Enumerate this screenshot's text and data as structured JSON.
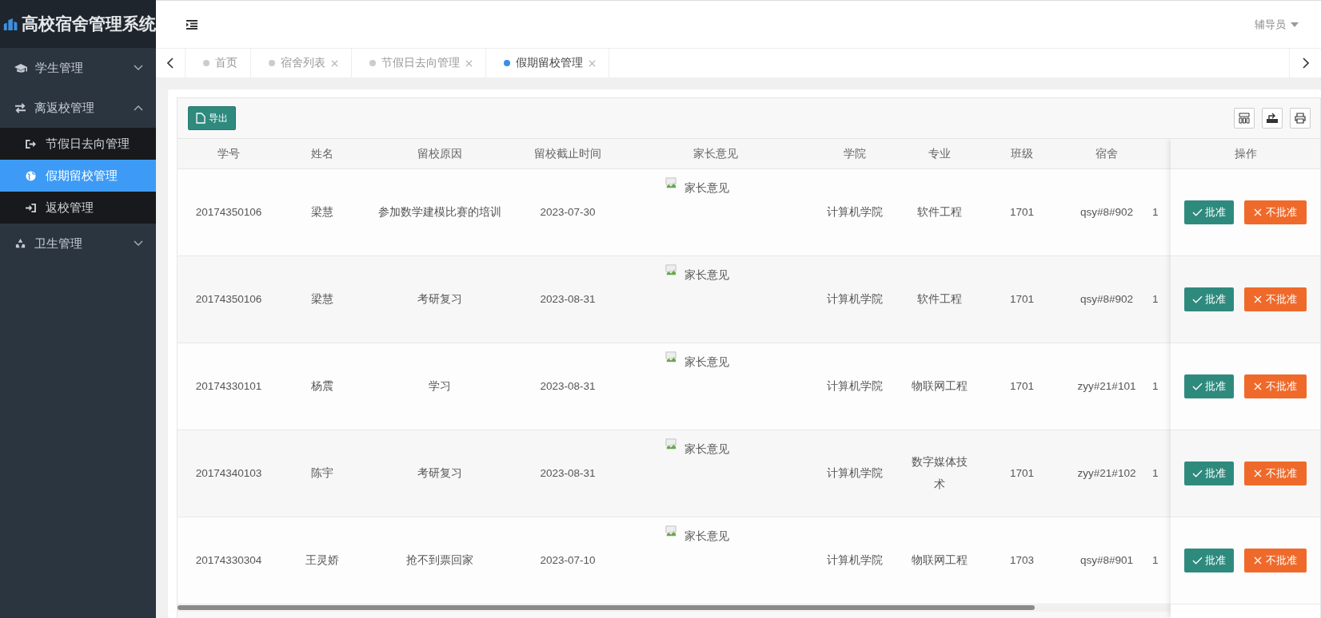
{
  "sidebar": {
    "logo": "高校宿舍管理系统",
    "items": [
      {
        "label": "学生管理",
        "expanded": false
      },
      {
        "label": "离返校管理",
        "expanded": true,
        "children": [
          {
            "label": "节假日去向管理",
            "selected": false
          },
          {
            "label": "假期留校管理",
            "selected": true
          },
          {
            "label": "返校管理",
            "selected": false
          }
        ]
      },
      {
        "label": "卫生管理",
        "expanded": false
      }
    ]
  },
  "header": {
    "user": "辅导员"
  },
  "tabs": [
    {
      "label": "首页",
      "selected": false,
      "closable": false
    },
    {
      "label": "宿舍列表",
      "selected": false,
      "closable": true
    },
    {
      "label": "节假日去向管理",
      "selected": false,
      "closable": true
    },
    {
      "label": "假期留校管理",
      "selected": true,
      "closable": true
    }
  ],
  "toolbar": {
    "export": "导出"
  },
  "table": {
    "columns": [
      {
        "label": "学号",
        "kind": "text"
      },
      {
        "label": "姓名",
        "kind": "text"
      },
      {
        "label": "留校原因",
        "kind": "text"
      },
      {
        "label": "留校截止时间",
        "kind": "text"
      },
      {
        "label": "家长意见",
        "kind": "image"
      },
      {
        "label": "学院",
        "kind": "text"
      },
      {
        "label": "专业",
        "kind": "text"
      },
      {
        "label": "班级",
        "kind": "text"
      },
      {
        "label": "宿舍",
        "kind": "text"
      }
    ],
    "actions_header": "操作",
    "rows": [
      {
        "cells": [
          "20174350106",
          "梁慧",
          "参加数学建模比赛的培训",
          "2023-07-30",
          "家长意见",
          "计算机学院",
          "软件工程",
          "1701",
          "qsy#8#902",
          "1"
        ],
        "actions": [
          {
            "kind": "approve",
            "label": "批准"
          },
          {
            "kind": "reject",
            "label": "不批准"
          }
        ]
      },
      {
        "cells": [
          "20174350106",
          "梁慧",
          "考研复习",
          "2023-08-31",
          "家长意见",
          "计算机学院",
          "软件工程",
          "1701",
          "qsy#8#902",
          "1"
        ],
        "actions": [
          {
            "kind": "approve",
            "label": "批准"
          },
          {
            "kind": "reject",
            "label": "不批准"
          }
        ]
      },
      {
        "cells": [
          "20174330101",
          "杨震",
          "学习",
          "2023-08-31",
          "家长意见",
          "计算机学院",
          "物联网工程",
          "1701",
          "zyy#21#101",
          "1"
        ],
        "actions": [
          {
            "kind": "approve",
            "label": "批准"
          },
          {
            "kind": "reject",
            "label": "不批准"
          }
        ]
      },
      {
        "cells": [
          "20174340103",
          "陈宇",
          "考研复习",
          "2023-08-31",
          "家长意见",
          "计算机学院",
          "数字媒体技术",
          "1701",
          "zyy#21#102",
          "1"
        ],
        "actions": [
          {
            "kind": "approve",
            "label": "批准"
          },
          {
            "kind": "reject",
            "label": "不批准"
          }
        ]
      },
      {
        "cells": [
          "20174330304",
          "王灵娇",
          "抢不到票回家",
          "2023-07-10",
          "家长意见",
          "计算机学院",
          "物联网工程",
          "1703",
          "qsy#8#901",
          "1"
        ],
        "actions": [
          {
            "kind": "approve",
            "label": "批准"
          },
          {
            "kind": "reject",
            "label": "不批准"
          }
        ]
      }
    ]
  }
}
